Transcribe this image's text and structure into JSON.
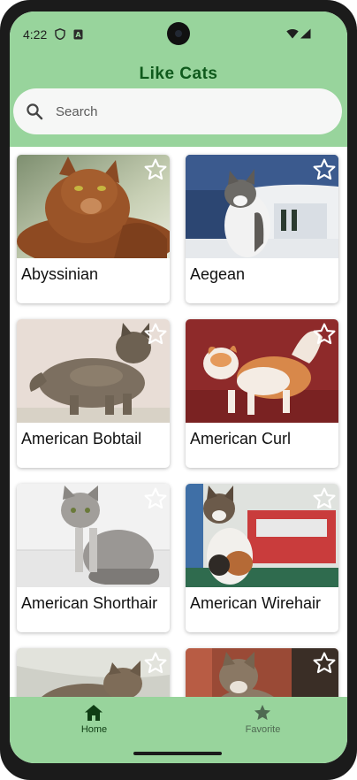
{
  "status_bar": {
    "time": "4:22",
    "icons": [
      "shield-icon",
      "sim-alert-icon",
      "wifi-icon",
      "signal-icon"
    ]
  },
  "app_bar": {
    "title": "Like Cats",
    "title_color": "#0f5a1c",
    "background": "#98d49c"
  },
  "search": {
    "placeholder": "Search",
    "value": ""
  },
  "cats": [
    {
      "name": "Abyssinian",
      "favorite": false
    },
    {
      "name": "Aegean",
      "favorite": false
    },
    {
      "name": "American Bobtail",
      "favorite": false
    },
    {
      "name": "American Curl",
      "favorite": false
    },
    {
      "name": "American Shorthair",
      "favorite": false
    },
    {
      "name": "American Wirehair",
      "favorite": false
    },
    {
      "name": "",
      "favorite": false
    },
    {
      "name": "",
      "favorite": false
    }
  ],
  "bottom_nav": {
    "items": [
      {
        "label": "Home",
        "icon": "home-icon",
        "selected": true
      },
      {
        "label": "Favorite",
        "icon": "star-icon",
        "selected": false
      }
    ],
    "selected_color": "#0f3d14",
    "unselected_color": "#4f6a52"
  }
}
